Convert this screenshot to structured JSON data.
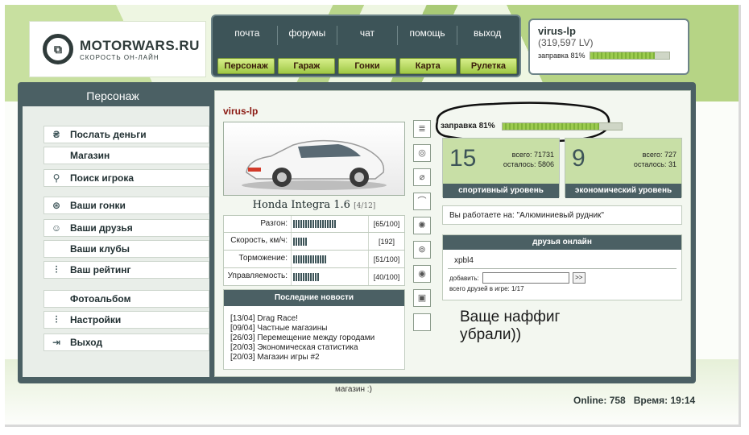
{
  "logo": {
    "title": "MOTORWARS.RU",
    "subtitle": "СКОРОСТЬ ОН-ЛАЙН"
  },
  "topnav": {
    "links": [
      "почта",
      "форумы",
      "чат",
      "помощь",
      "выход"
    ],
    "buttons": [
      "Персонаж",
      "Гараж",
      "Гонки",
      "Карта",
      "Рулетка"
    ]
  },
  "user": {
    "name": "virus-lp",
    "lv": "(319,597 LV)",
    "fuel_label": "заправка 81%",
    "fuel_pct": 81
  },
  "section_title": "Персонаж",
  "menu": [
    {
      "label": "Послать деньги",
      "icon": "money-icon"
    },
    {
      "label": "Магазин",
      "icon": ""
    },
    {
      "label": "Поиск игрока",
      "icon": "search-icon"
    },
    {
      "label": "Ваши гонки",
      "icon": "steering-wheel-icon"
    },
    {
      "label": "Ваши друзья",
      "icon": "friends-icon"
    },
    {
      "label": "Ваши клубы",
      "icon": ""
    },
    {
      "label": "Ваш рейтинг",
      "icon": "equalizer-icon"
    },
    {
      "label": "Фотоальбом",
      "icon": ""
    },
    {
      "label": "Настройки",
      "icon": "equalizer-icon"
    },
    {
      "label": "Выход",
      "icon": "exit-icon"
    }
  ],
  "car": {
    "owner": "virus-lp",
    "model": "Honda Integra 1.6",
    "slot": "[4/12]",
    "stats": [
      {
        "label": "Разгон:",
        "value": "[65/100]",
        "level": 65
      },
      {
        "label": "Скорость, км/ч:",
        "value": "[192]",
        "level": 20
      },
      {
        "label": "Торможение:",
        "value": "[51/100]",
        "level": 51
      },
      {
        "label": "Управляемость:",
        "value": "[40/100]",
        "level": 40
      }
    ]
  },
  "news": {
    "title": "Последние новости",
    "items": [
      "[13/04] Drag Race!",
      "[09/04] Частные магазины",
      "[26/03] Перемещение между городами",
      "[20/03] Экономическая статистика",
      "[20/03] Магазин игры #2"
    ]
  },
  "fuel_main": {
    "label": "заправка 81%",
    "pct": 81
  },
  "sport": {
    "level": "15",
    "total_label": "всего:",
    "total": "71731",
    "left_label": "осталось:",
    "left": "5806",
    "title": "спортивный уровень"
  },
  "econ": {
    "level": "9",
    "total_label": "всего:",
    "total": "727",
    "left_label": "осталось:",
    "left": "31",
    "title": "экономический уровень"
  },
  "work": {
    "text": "Вы работаете на: \"Алюминиевый рудник\""
  },
  "friends": {
    "title": "друзья онлайн",
    "name": "xpbl4",
    "add_label": "добавить:",
    "go": ">>",
    "count": "всего друзей в игре: 1/17"
  },
  "note": {
    "line1": "Ваще наффиг",
    "line2": "убрали))"
  },
  "footer": {
    "status": "магазин :)",
    "online_label": "Online:",
    "online": "758",
    "time_label": "Время:",
    "time": "19:14"
  }
}
